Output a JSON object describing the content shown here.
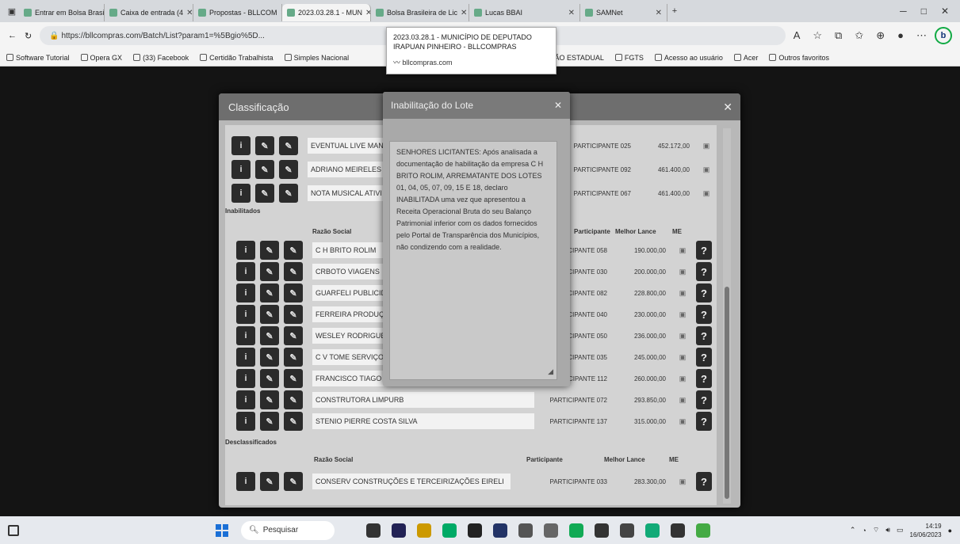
{
  "browser": {
    "tabs": [
      {
        "label": "Entrar em Bolsa Brasi"
      },
      {
        "label": "Caixa de entrada (4"
      },
      {
        "label": "Propostas - BLLCOM"
      },
      {
        "label": "2023.03.28.1 - MUN"
      },
      {
        "label": "Bolsa Brasileira de Lic"
      },
      {
        "label": "Lucas BBAI"
      },
      {
        "label": "SAMNet"
      }
    ],
    "url": "https://bllcompras.com/Batch/List?param1=%5Bgio%5D...",
    "bookmarks": [
      "Software Tutorial",
      "Opera GX",
      "(33) Facebook",
      "Certidão Trabalhista",
      "Simples Nacional",
      "CERTIDÃO ESTADUAL",
      "FGTS",
      "Acesso ao usuário",
      "Acer",
      "Outros favoritos"
    ]
  },
  "tooltip": {
    "title": "2023.03.28.1 - MUNICÍPIO DE DEPUTADO IRAPUAN PINHEIRO - BLLCOMPRAS",
    "site": "bllcompras.com"
  },
  "modal": {
    "title": "Classificação",
    "top_rows": [
      {
        "name": "EVENTUAL LIVE MANE",
        "participant": "PARTICIPANTE 025",
        "bid": "452.172,00"
      },
      {
        "name": "ADRIANO MEIRELES C",
        "participant": "PARTICIPANTE 092",
        "bid": "461.400,00"
      },
      {
        "name": "NOTA MUSICAL ATIVI",
        "participant": "PARTICIPANTE 067",
        "bid": "461.400,00"
      }
    ],
    "section_inabilitados": "Inabilitados",
    "headers": {
      "razao": "Razão Social",
      "participante": "Participante",
      "lance": "Melhor Lance",
      "me": "ME"
    },
    "inab_rows": [
      {
        "name": "C H BRITO ROLIM",
        "participant": "PARTICIPANTE 058",
        "bid": "190.000,00"
      },
      {
        "name": "CRBOTO VIAGENS",
        "participant": "PARTICIPANTE 030",
        "bid": "200.000,00"
      },
      {
        "name": "GUARFELI PUBLICIDA",
        "participant": "PARTICIPANTE 082",
        "bid": "228.800,00"
      },
      {
        "name": "FERREIRA PRODUÇÕ",
        "participant": "PARTICIPANTE 040",
        "bid": "230.000,00"
      },
      {
        "name": "WESLEY RODRIGUES",
        "participant": "PARTICIPANTE 050",
        "bid": "236.000,00"
      },
      {
        "name": "C V TOME SERVIÇOS",
        "participant": "PARTICIPANTE 035",
        "bid": "245.000,00"
      },
      {
        "name": "FRANCISCO TIAGO LE",
        "participant": "PARTICIPANTE 112",
        "bid": "260.000,00"
      },
      {
        "name": "CONSTRUTORA LIMPURB",
        "participant": "PARTICIPANTE 072",
        "bid": "293.850,00"
      },
      {
        "name": "STENIO PIERRE COSTA SILVA",
        "participant": "PARTICIPANTE 137",
        "bid": "315.000,00"
      }
    ],
    "section_desclassificados": "Desclassificados",
    "descl_rows": [
      {
        "name": "CONSERV CONSTRUÇÕES E TERCEIRIZAÇÕES EIRELI",
        "participant": "PARTICIPANTE 033",
        "bid": "283.300,00"
      }
    ]
  },
  "dialog": {
    "title": "Inabilitação do Lote",
    "text": "SENHORES LICITANTES: Após analisada a documentação de habilitação da empresa C H BRITO ROLIM, ARREMATANTE DOS LOTES 01, 04, 05, 07, 09, 15 E 18, declaro INABILITADA uma vez que apresentou a Receita Operacional Bruta do seu Balanço Patrimonial inferior com os dados fornecidos pelo Portal de Transparência dos Municípios, não condizendo com a realidade."
  },
  "taskbar": {
    "search_placeholder": "Pesquisar",
    "time": "14:19",
    "date": "16/06/2023"
  }
}
